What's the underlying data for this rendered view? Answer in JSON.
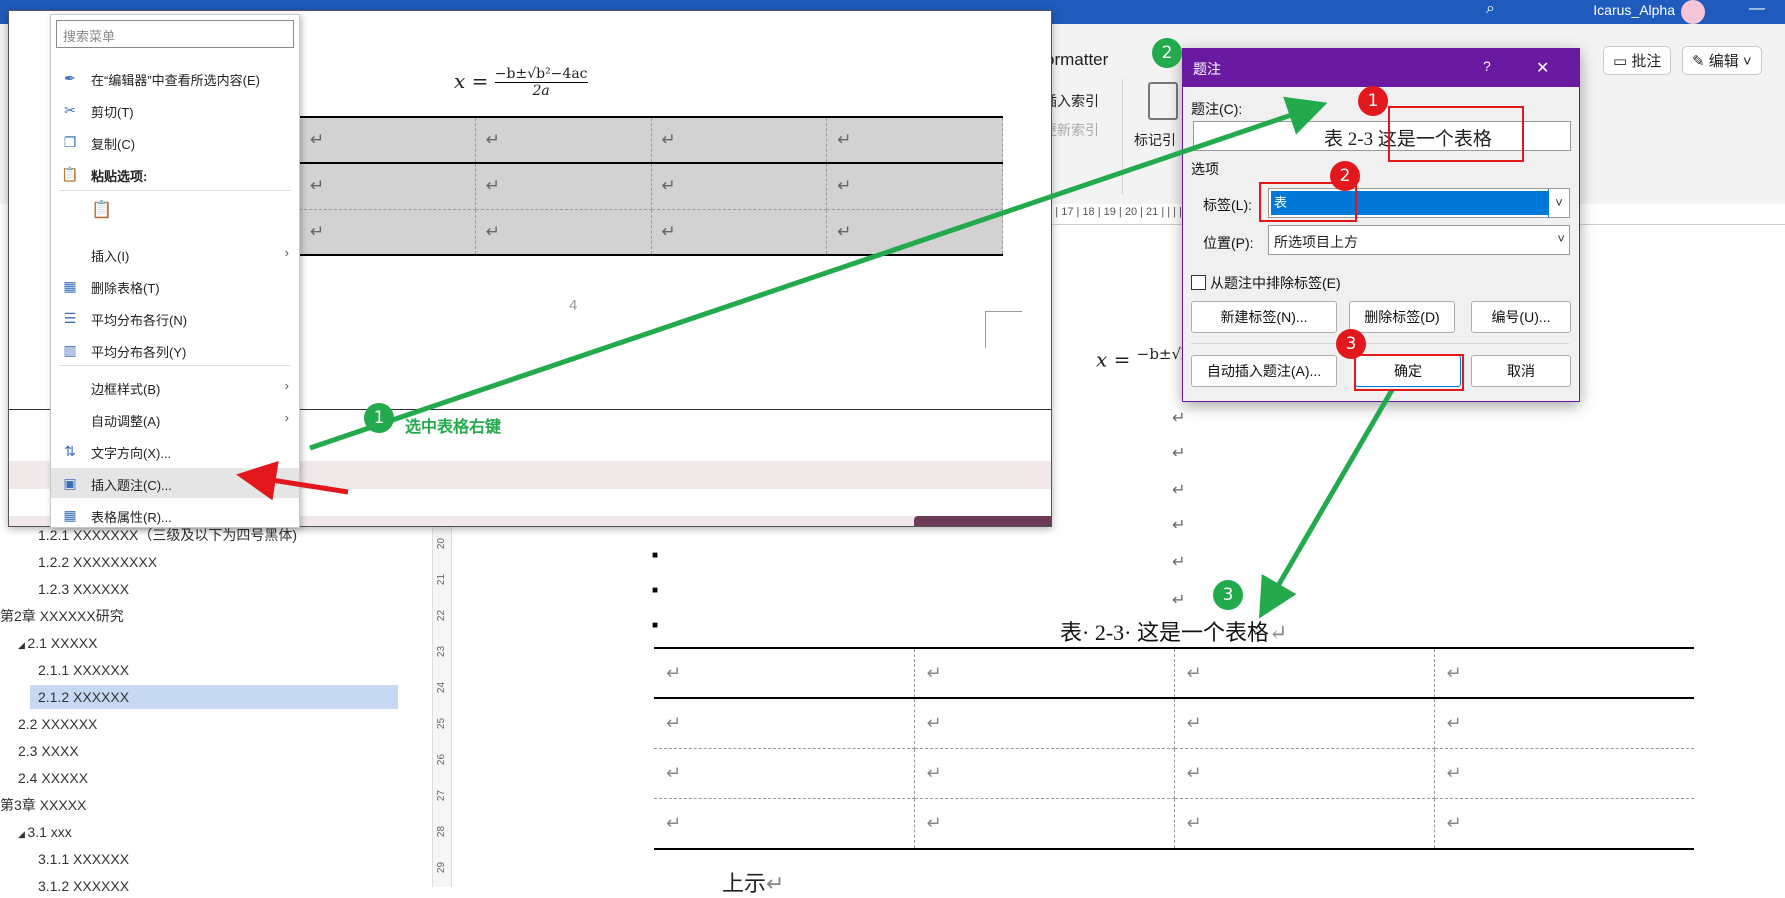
{
  "window": {
    "user_name": "Icarus_Alpha",
    "search_icon": "search-icon",
    "minimize_glyph": "—"
  },
  "ribbon": {
    "formatter_tab": "ormatter",
    "comment_button": "批注",
    "edit_button": "编辑",
    "insert_index": "插入索引",
    "update_index": "更新索引",
    "mark_entry": "标记引",
    "ruler_text": "16 | 17 | 18 | 19 | 20 | 21 |  |  |  |  |  |  |  |  |  |  |  |  |  |  |  |  |  |  |  |  |  |  | 38 | 39 | 40 | 41"
  },
  "nav_pane": {
    "items": [
      {
        "label": "1.2.1 XXXXXXX（三级及以下为四号黑体)",
        "level": 3
      },
      {
        "label": "1.2.2 XXXXXXXXX",
        "level": 3
      },
      {
        "label": "1.2.3 XXXXXX",
        "level": 3
      },
      {
        "label": "第2章 XXXXXX研究",
        "level": 1
      },
      {
        "label": "2.1 XXXXX",
        "level": 2,
        "expanded": true
      },
      {
        "label": "2.1.1 XXXXXX",
        "level": 3
      },
      {
        "label": "2.1.2 XXXXXX",
        "level": 3,
        "selected": true
      },
      {
        "label": "2.2 XXXXXX",
        "level": 2
      },
      {
        "label": "2.3 XXXX",
        "level": 2
      },
      {
        "label": "2.4 XXXXX",
        "level": 2
      },
      {
        "label": "第3章 XXXXX",
        "level": 1
      },
      {
        "label": "3.1 xxx",
        "level": 2,
        "expanded": true
      },
      {
        "label": "3.1.1 XXXXXX",
        "level": 3
      },
      {
        "label": "3.1.2 XXXXXX",
        "level": 3
      }
    ],
    "vertical_ruler": [
      "20",
      "21",
      "22",
      "23",
      "24",
      "25",
      "26",
      "27",
      "28",
      "29"
    ]
  },
  "document": {
    "formula_left": "x =",
    "formula_num": "−b±√b²−4ac",
    "formula_den": "2a",
    "para_mark": "↵",
    "caption": "表· 2-3· 这是一个表格",
    "bottom_text": "上示",
    "table_rows": 4,
    "table_cols": 4
  },
  "inset": {
    "page_number": "4",
    "table_rows": 3,
    "table_cols": 4
  },
  "context_menu": {
    "search_placeholder": "搜索菜单",
    "items": [
      {
        "label": "在“编辑器”中查看所选内容(E)",
        "icon": "pen-icon"
      },
      {
        "label": "剪切(T)",
        "icon": "scissors-icon"
      },
      {
        "label": "复制(C)",
        "icon": "copy-icon"
      },
      {
        "label": "粘贴选项:",
        "icon": "clipboard-icon"
      },
      {
        "label": "插入(I)",
        "icon": "",
        "submenu": true
      },
      {
        "label": "删除表格(T)",
        "icon": "delete-table-icon"
      },
      {
        "label": "平均分布各行(N)",
        "icon": "distribute-rows-icon"
      },
      {
        "label": "平均分布各列(Y)",
        "icon": "distribute-columns-icon"
      },
      {
        "label": "边框样式(B)",
        "icon": "",
        "submenu": true
      },
      {
        "label": "自动调整(A)",
        "icon": "",
        "submenu": true
      },
      {
        "label": "文字方向(X)...",
        "icon": "text-direction-icon"
      },
      {
        "label": "插入题注(C)...",
        "icon": "insert-caption-icon",
        "highlighted": true
      },
      {
        "label": "表格属性(R)...",
        "icon": "table-properties-icon"
      }
    ]
  },
  "caption_dialog": {
    "title": "题注",
    "help": "?",
    "close": "✕",
    "caption_label": "题注(C):",
    "caption_value": "表  2-3  这是一个表格",
    "options_header": "选项",
    "label_label": "标签(L):",
    "label_value": "表",
    "position_label": "位置(P):",
    "position_value": "所选项目上方",
    "exclude_label": "从题注中排除标签(E)",
    "exclude_checked": false,
    "new_label_button": "新建标签(N)...",
    "delete_label_button": "删除标签(D)",
    "numbering_button": "编号(U)...",
    "autocaption_button": "自动插入题注(A)...",
    "ok_button": "确定",
    "cancel_button": "取消"
  },
  "annotations": {
    "step1_text": "选中表格右键",
    "badges": [
      "1",
      "2",
      "3"
    ],
    "green": "#22aa4c",
    "red": "#e3181d",
    "dialog_purple": "#6a1aa0"
  }
}
